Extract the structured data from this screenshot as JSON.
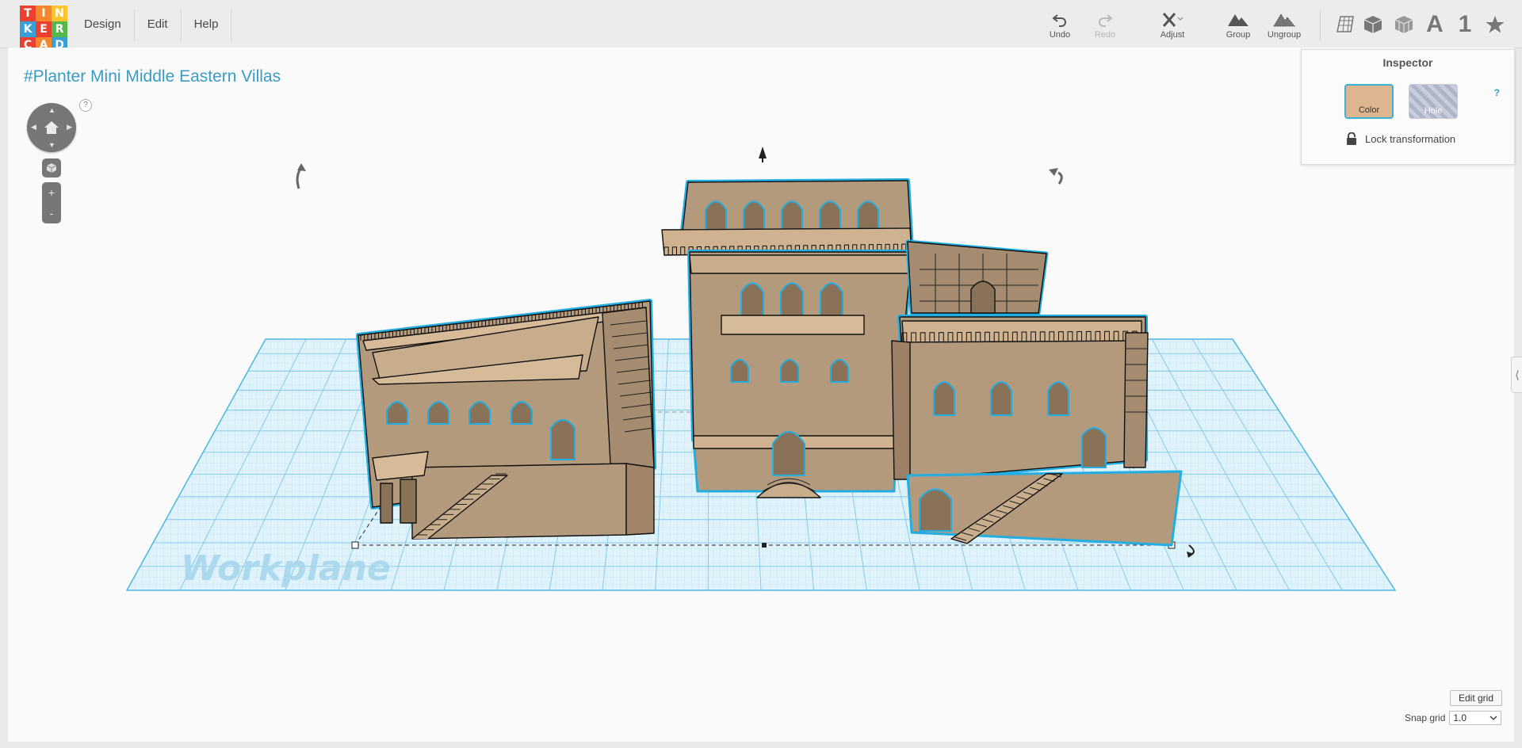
{
  "app": {
    "logo_letters": [
      "T",
      "I",
      "N",
      "K",
      "E",
      "R",
      "C",
      "A",
      "D"
    ],
    "logo_colors": [
      "#e9402f",
      "#f5882a",
      "#fbc52e",
      "#3a9fd6",
      "#e9402f",
      "#54b84a",
      "#e9402f",
      "#f5882a",
      "#3a9fd6"
    ]
  },
  "menu": {
    "items": [
      "Design",
      "Edit",
      "Help"
    ]
  },
  "toolbar": {
    "undo": "Undo",
    "redo": "Redo",
    "adjust": "Adjust",
    "group": "Group",
    "ungroup": "Ungroup",
    "views": {
      "letter_a": "A",
      "number_one": "1"
    }
  },
  "project": {
    "title": "#Planter Mini Middle Eastern Villas"
  },
  "workplane": {
    "label": "Workplane"
  },
  "inspector": {
    "title": "Inspector",
    "help": "?",
    "color_label": "Color",
    "hole_label": "Hole",
    "lock_label": "Lock transformation"
  },
  "nav": {
    "help": "?",
    "zoom_in": "+",
    "zoom_out": "-"
  },
  "grid": {
    "edit_label": "Edit grid",
    "snap_label": "Snap grid",
    "snap_value": "1.0"
  },
  "colors": {
    "accent": "#3a9cc4",
    "selection": "#26aee0",
    "building": "#b59a7c",
    "grid": "#9cd3ea"
  }
}
